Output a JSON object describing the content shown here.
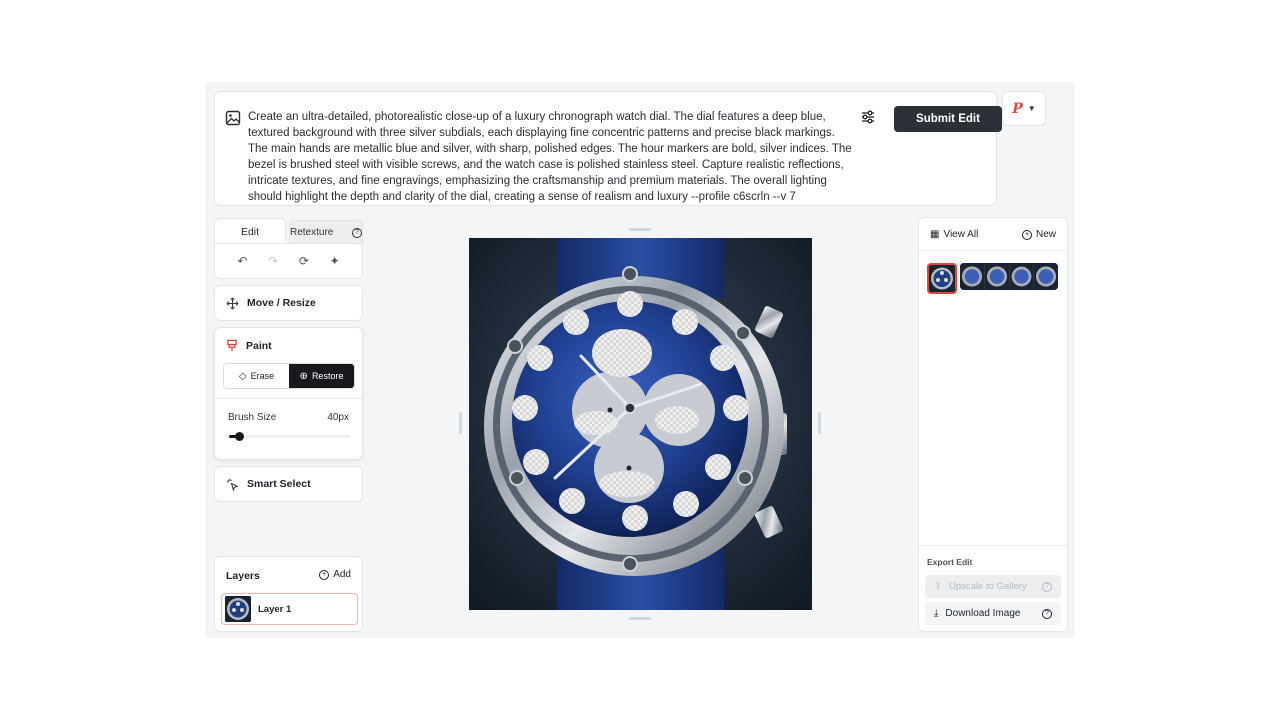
{
  "prompt": {
    "text": "Create an ultra-detailed, photorealistic close-up of a luxury chronograph watch dial. The dial features a deep blue, textured background with three silver subdials, each displaying fine concentric patterns and precise black markings. The main hands are metallic blue and silver, with sharp, polished edges. The hour markers are bold, silver indices. The bezel is brushed steel with visible screws, and the watch case is polished stainless steel. Capture realistic reflections, intricate textures, and fine engravings, emphasizing the craftsmanship and premium materials. The overall lighting should highlight the depth and clarity of the dial, creating a sense of realism and luxury --profile c6scrln --v 7",
    "submit_label": "Submit Edit",
    "avatar_letter": "P"
  },
  "tabs": {
    "edit_label": "Edit",
    "retexture_label": "Retexture"
  },
  "tools": {
    "move_label": "Move / Resize",
    "paint_label": "Paint",
    "erase_label": "Erase",
    "restore_label": "Restore",
    "brush_size_label": "Brush Size",
    "brush_size_value": "40px",
    "brush_size_fraction": 0.05,
    "smart_select_label": "Smart Select"
  },
  "layers": {
    "title": "Layers",
    "add_label": "Add",
    "items": [
      {
        "label": "Layer 1"
      }
    ]
  },
  "gallery": {
    "view_all_label": "View All",
    "new_label": "New",
    "export_label": "Export Edit",
    "upscale_label": "Upscale to Gallery",
    "download_label": "Download Image"
  },
  "colors": {
    "accent": "#e0493a",
    "dark_button": "#2b2f36",
    "watch_dial_blue": "#1d3c7c"
  }
}
